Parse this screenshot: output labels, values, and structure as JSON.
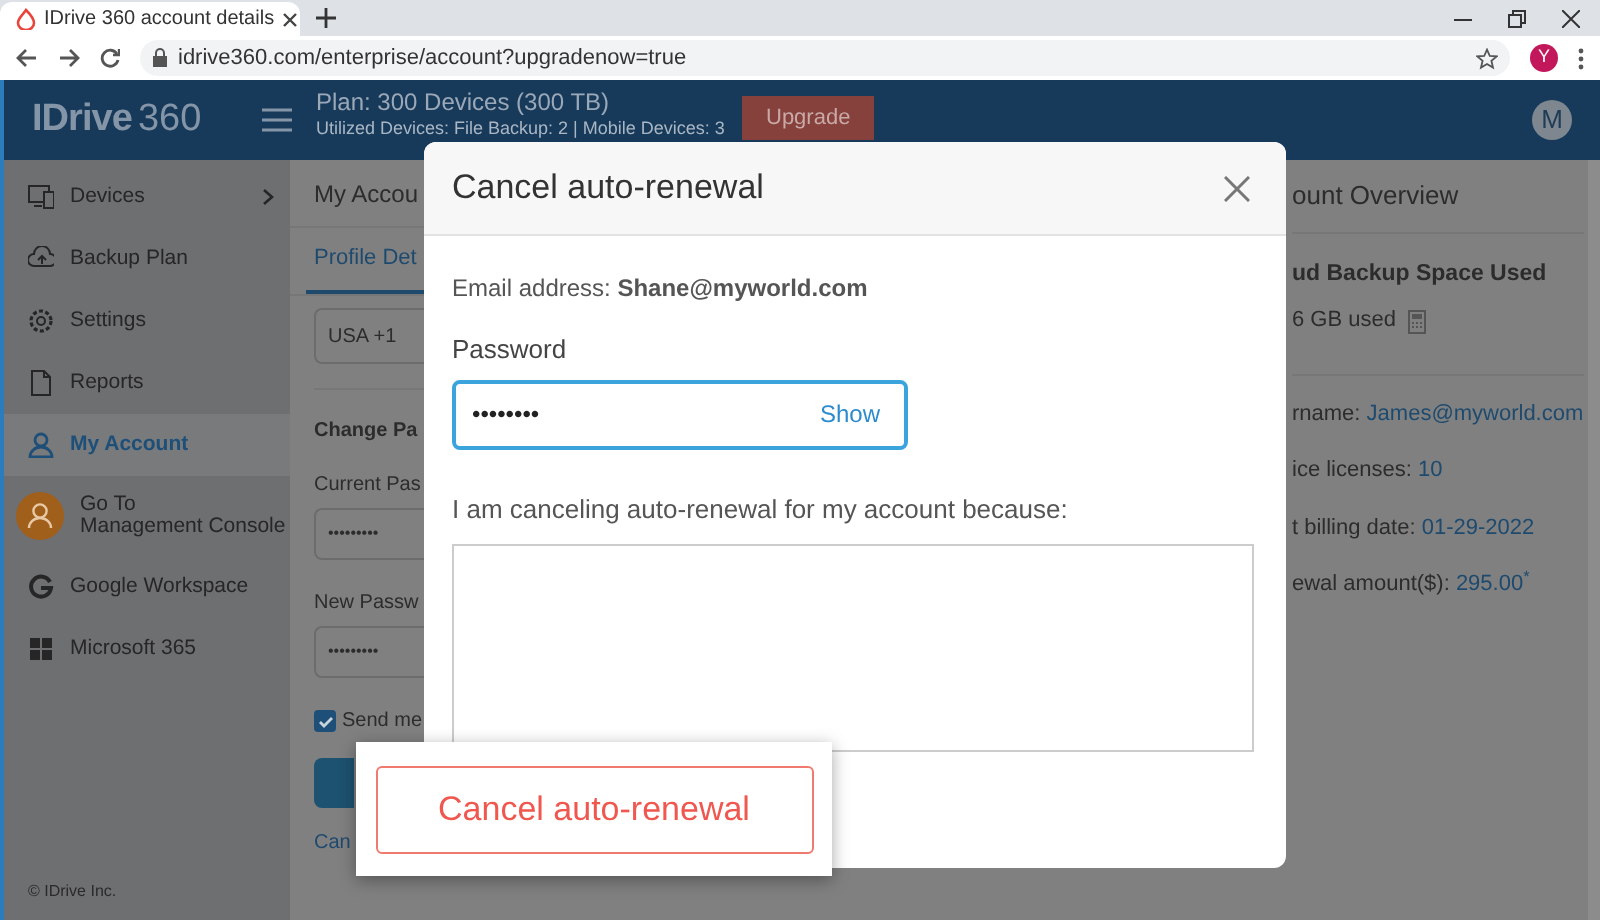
{
  "browser": {
    "tab_title": "IDrive 360 account details",
    "url": "idrive360.com/enterprise/account?upgradenow=true",
    "profile_initial": "Y"
  },
  "header": {
    "logo_text": "IDrive",
    "logo_suffix": "360",
    "plan": "Plan: 300 Devices (300 TB)",
    "utilized": "Utilized Devices: File Backup: 2 | Mobile Devices: 3",
    "upgrade_button": "Upgrade",
    "avatar_initial": "M"
  },
  "sidebar": {
    "items": [
      {
        "label": "Devices",
        "selected": false,
        "has_submenu": true
      },
      {
        "label": "Backup Plan",
        "selected": false,
        "has_submenu": false
      },
      {
        "label": "Settings",
        "selected": false,
        "has_submenu": false
      },
      {
        "label": "Reports",
        "selected": false,
        "has_submenu": false
      },
      {
        "label": "My Account",
        "selected": true,
        "has_submenu": false
      },
      {
        "label": "Go To\nManagement Console",
        "selected": false,
        "has_submenu": false
      },
      {
        "label": "Google Workspace",
        "selected": false,
        "has_submenu": false
      },
      {
        "label": "Microsoft 365",
        "selected": false,
        "has_submenu": false
      }
    ],
    "footer": "© IDrive Inc."
  },
  "account_page": {
    "title": "My Accou",
    "tab": "Profile Det",
    "country_code": "USA +1",
    "section": "Change Pa",
    "current_password_label": "Current Pas",
    "current_password": "•••••••••",
    "new_password_label": "New Passw",
    "new_password": "•••••••••",
    "send_email": {
      "label": "Send me",
      "checked": true
    },
    "cancel_link": "Can"
  },
  "overview": {
    "title": "ount Overview",
    "space_heading": "ud Backup Space Used",
    "space_used": "6 GB used",
    "fields": [
      {
        "label": "rname: ",
        "value": "James@myworld.com"
      },
      {
        "label": "ice licenses: ",
        "value": "10"
      },
      {
        "label": "t billing date: ",
        "value": "01-29-2022"
      },
      {
        "label": "ewal amount($): ",
        "value": "295.00$^{*}$"
      }
    ]
  },
  "dialog": {
    "title": "Cancel auto-renewal",
    "email": "Email address: **Shane@myworld.com**",
    "password_label": "Password",
    "password": "••••••••",
    "show_button": "Show",
    "reason_label": "I am canceling auto-renewal for my account because:",
    "submit_button": "Cancel auto-renewal"
  }
}
